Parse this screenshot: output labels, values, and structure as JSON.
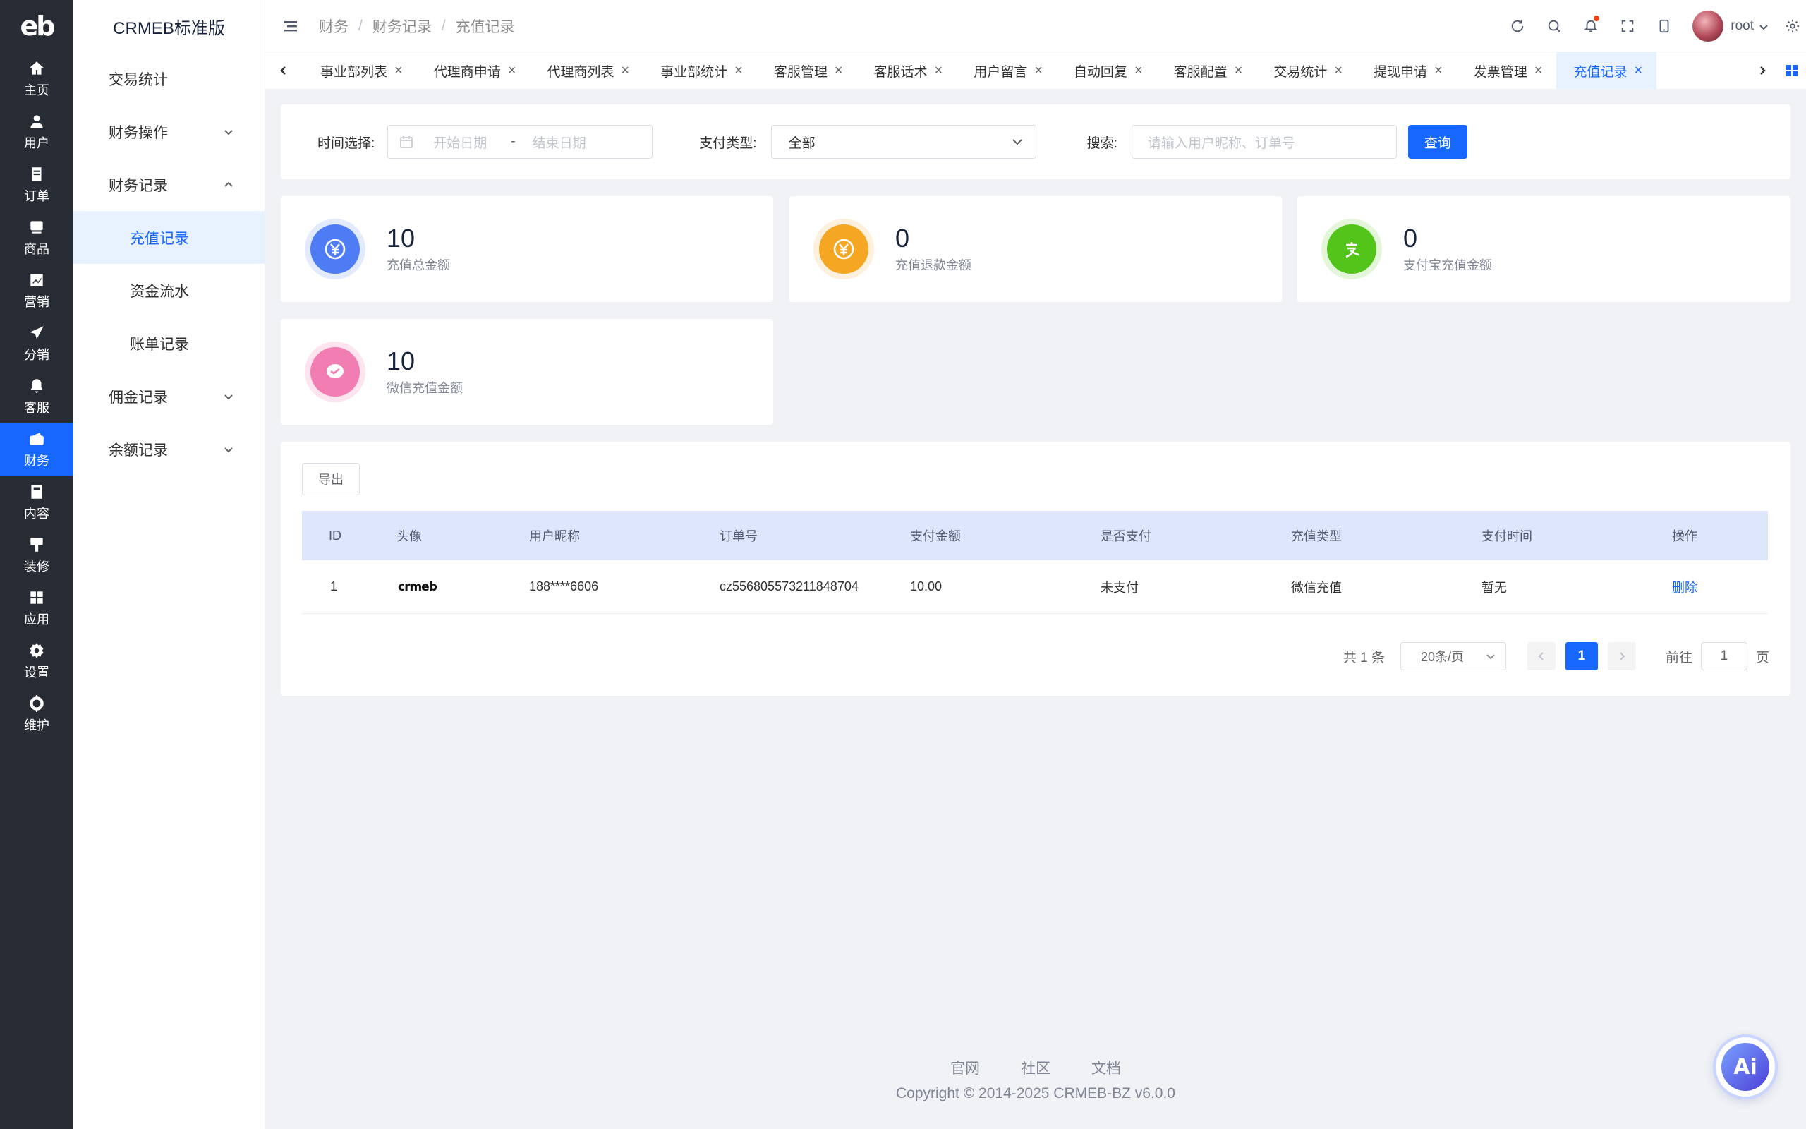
{
  "rail": {
    "logo": "eb",
    "items": [
      {
        "label": "主页",
        "icon": "home-icon"
      },
      {
        "label": "用户",
        "icon": "user-icon"
      },
      {
        "label": "订单",
        "icon": "order-icon"
      },
      {
        "label": "商品",
        "icon": "product-icon"
      },
      {
        "label": "营销",
        "icon": "marketing-icon"
      },
      {
        "label": "分销",
        "icon": "distribution-icon"
      },
      {
        "label": "客服",
        "icon": "service-icon"
      },
      {
        "label": "财务",
        "icon": "finance-icon"
      },
      {
        "label": "内容",
        "icon": "content-icon"
      },
      {
        "label": "装修",
        "icon": "decoration-icon"
      },
      {
        "label": "应用",
        "icon": "apps-icon"
      },
      {
        "label": "设置",
        "icon": "settings-icon"
      },
      {
        "label": "维护",
        "icon": "maintenance-icon"
      }
    ],
    "active_index": 7
  },
  "sidebar": {
    "title": "CRMEB标准版",
    "items": [
      {
        "label": "交易统计"
      },
      {
        "label": "财务操作"
      },
      {
        "label": "财务记录"
      },
      {
        "label": "充值记录"
      },
      {
        "label": "资金流水"
      },
      {
        "label": "账单记录"
      },
      {
        "label": "佣金记录"
      },
      {
        "label": "余额记录"
      }
    ]
  },
  "header": {
    "breadcrumb": [
      "财务",
      "财务记录",
      "充值记录"
    ],
    "user": "root"
  },
  "tabs": [
    "事业部列表",
    "代理商申请",
    "代理商列表",
    "事业部统计",
    "客服管理",
    "客服话术",
    "用户留言",
    "自动回复",
    "客服配置",
    "交易统计",
    "提现申请",
    "发票管理",
    "充值记录"
  ],
  "filter": {
    "time_label": "时间选择:",
    "start_placeholder": "开始日期",
    "range_sep": "-",
    "end_placeholder": "结束日期",
    "pay_type_label": "支付类型:",
    "pay_type_value": "全部",
    "search_label": "搜索:",
    "search_placeholder": "请输入用户昵称、订单号",
    "query_button": "查询"
  },
  "stats": [
    {
      "value": "10",
      "label": "充值总金额",
      "color": "#4d7cf4"
    },
    {
      "value": "0",
      "label": "充值退款金额",
      "color": "#f5a623"
    },
    {
      "value": "0",
      "label": "支付宝充值金额",
      "color": "#52c41a"
    },
    {
      "value": "10",
      "label": "微信充值金额",
      "color": "#f27db3"
    }
  ],
  "table": {
    "export_button": "导出",
    "columns": [
      "ID",
      "头像",
      "用户昵称",
      "订单号",
      "支付金额",
      "是否支付",
      "充值类型",
      "支付时间",
      "操作"
    ],
    "rows": [
      {
        "id": "1",
        "avatar": "crmeb",
        "nickname": "188****6606",
        "order_no": "cz556805573211848704",
        "amount": "10.00",
        "paid": "未支付",
        "type": "微信充值",
        "pay_time": "暂无",
        "action": "删除"
      }
    ]
  },
  "pagination": {
    "total": "共 1 条",
    "page_size": "20条/页",
    "current": "1",
    "goto_label": "前往",
    "goto_value": "1",
    "goto_suffix": "页"
  },
  "footer": {
    "links": [
      "官网",
      "社区",
      "文档"
    ],
    "copyright": "Copyright © 2014-2025 CRMEB-BZ v6.0.0"
  },
  "ai_button": "Ai",
  "colors": {
    "primary": "#1567ff",
    "rail_bg": "#282c34"
  }
}
